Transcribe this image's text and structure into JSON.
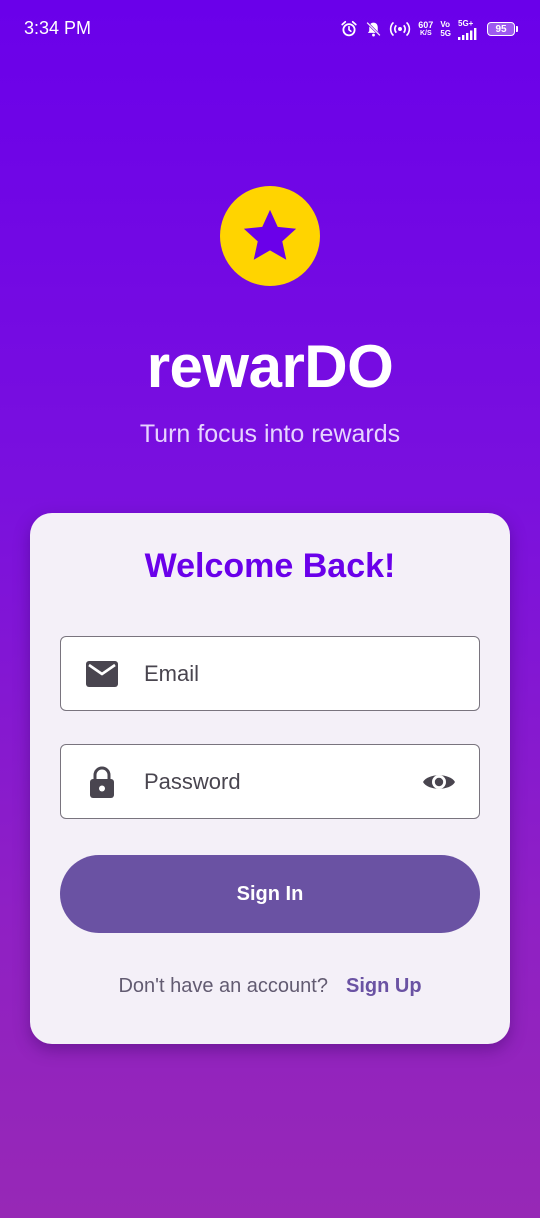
{
  "status_bar": {
    "time": "3:34 PM",
    "net_speed_value": "607",
    "net_speed_unit": "K/S",
    "vo_label": "Vo",
    "network_label": "5G",
    "network_plus_label": "5G+",
    "battery_level": "95",
    "icons": [
      "alarm-icon",
      "bell-off-icon",
      "hotspot-icon",
      "signal-icon",
      "battery-icon"
    ]
  },
  "app": {
    "logo_icon": "star-icon",
    "title": "rewarDO",
    "tagline": "Turn focus into rewards"
  },
  "login_card": {
    "heading": "Welcome Back!",
    "email_placeholder": "Email",
    "email_icon": "mail-icon",
    "password_placeholder": "Password",
    "password_icon": "lock-icon",
    "password_toggle_icon": "eye-icon",
    "sign_in_label": "Sign In",
    "signup_prompt": "Don't have an account?",
    "signup_link": "Sign Up"
  },
  "colors": {
    "background_top": "#6a00ea",
    "background_bottom": "#9728b6",
    "logo_yellow": "#ffd400",
    "heading_purple": "#6a00ea",
    "button_purple": "#6a52a3",
    "card_background": "#f4f0f8"
  }
}
